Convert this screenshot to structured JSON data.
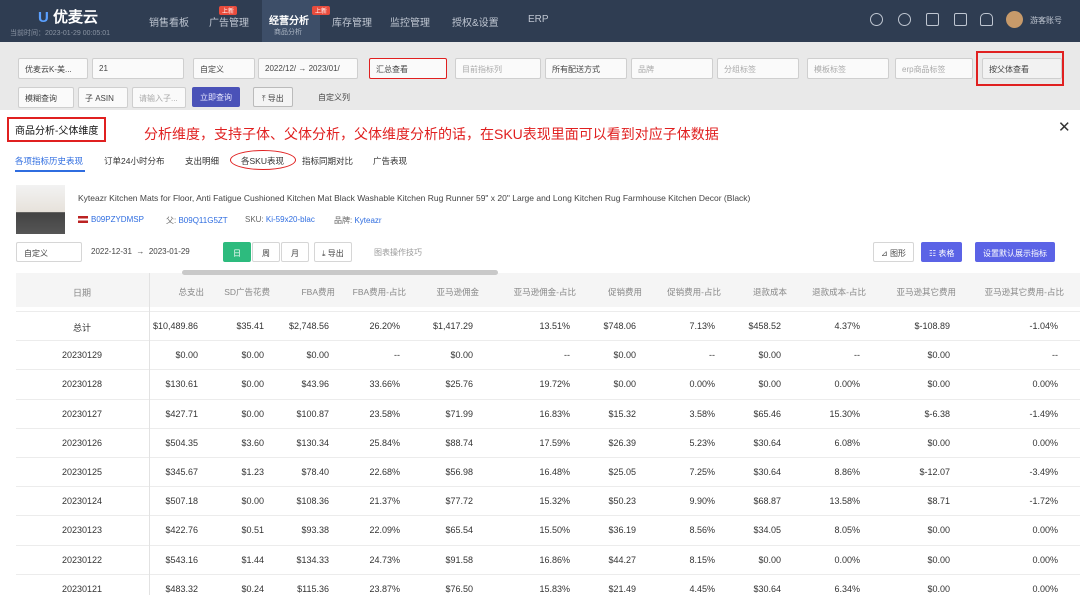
{
  "app": {
    "logo": "优麦云",
    "sub": "当前时间：2023-01-29 00:05:01"
  },
  "nav": [
    {
      "label": "销售看板",
      "badge": ""
    },
    {
      "label": "广告管理",
      "badge": "上新"
    },
    {
      "label": "经营分析",
      "badge": "上新",
      "sub": "商品分析"
    },
    {
      "label": "库存管理",
      "badge": ""
    },
    {
      "label": "监控管理",
      "badge": ""
    },
    {
      "label": "授权&设置",
      "badge": ""
    },
    {
      "label": "ERP",
      "badge": ""
    }
  ],
  "user": {
    "name": "游客账号"
  },
  "filters": {
    "store": "优麦云K-美...",
    "count": "21",
    "mode": "自定义",
    "start": "2022/12/",
    "end": "2023/01/",
    "summary": "汇总查看",
    "p1": "目前指标列",
    "ship": "所有配送方式",
    "p2": "品牌",
    "p3": "分组标签",
    "p4": "模板标签",
    "p5": "erp商品标签",
    "parent_view": "按父体查看",
    "search_mode": "模糊查询",
    "asin": "子 ASIN",
    "asin_ph": "请输入子...",
    "search_btn": "立即查询",
    "export": "导出",
    "custom_cols": "自定义列"
  },
  "panel": {
    "title": "商品分析-父体维度",
    "annotation": "分析维度，支持子体、父体分析，父体维度分析的话，在SKU表现里面可以看到对应子体数据",
    "tabs": [
      "各项指标历史表现",
      "订单24小时分布",
      "支出明细",
      "各SKU表现",
      "指标同期对比",
      "广告表现"
    ],
    "product": {
      "name": "Kyteazr Kitchen Mats for Floor, Anti Fatigue Cushioned Kitchen Mat Black Washable Kitchen Rug Runner 59\" x 20\" Large and Long Kitchen Rug Farmhouse Kitchen Decor (Black)",
      "asin": "B09PZYDMSP",
      "parent_label": "父:",
      "parent": "B09Q11G5ZT",
      "sku_label": "SKU:",
      "sku": "Ki-59x20-blac",
      "brand_label": "品牌:",
      "brand": "Kyteazr"
    },
    "controls": {
      "mode": "自定义",
      "start": "2022-12-31",
      "arrow": "→",
      "end": "2023-01-29",
      "day": "日",
      "week": "周",
      "month": "月",
      "export": "导出",
      "tip": "图表操作技巧",
      "chart": "图形",
      "table": "表格",
      "default_btn": "设置默认展示指标"
    }
  },
  "table": {
    "headers": [
      "日期",
      "总支出",
      "SD广告花费",
      "FBA费用",
      "FBA费用-占比",
      "亚马逊佣金",
      "亚马逊佣金-占比",
      "促销费用",
      "促销费用-占比",
      "退款成本",
      "退款成本-占比",
      "亚马逊其它费用",
      "亚马逊其它费用-占比"
    ],
    "rows": [
      [
        "总计",
        "$10,489.86",
        "$35.41",
        "$2,748.56",
        "26.20%",
        "$1,417.29",
        "13.51%",
        "$748.06",
        "7.13%",
        "$458.52",
        "4.37%",
        "$-108.89",
        "-1.04%"
      ],
      [
        "20230129",
        "$0.00",
        "$0.00",
        "$0.00",
        "--",
        "$0.00",
        "--",
        "$0.00",
        "--",
        "$0.00",
        "--",
        "$0.00",
        "--"
      ],
      [
        "20230128",
        "$130.61",
        "$0.00",
        "$43.96",
        "33.66%",
        "$25.76",
        "19.72%",
        "$0.00",
        "0.00%",
        "$0.00",
        "0.00%",
        "$0.00",
        "0.00%"
      ],
      [
        "20230127",
        "$427.71",
        "$0.00",
        "$100.87",
        "23.58%",
        "$71.99",
        "16.83%",
        "$15.32",
        "3.58%",
        "$65.46",
        "15.30%",
        "$-6.38",
        "-1.49%"
      ],
      [
        "20230126",
        "$504.35",
        "$3.60",
        "$130.34",
        "25.84%",
        "$88.74",
        "17.59%",
        "$26.39",
        "5.23%",
        "$30.64",
        "6.08%",
        "$0.00",
        "0.00%"
      ],
      [
        "20230125",
        "$345.67",
        "$1.23",
        "$78.40",
        "22.68%",
        "$56.98",
        "16.48%",
        "$25.05",
        "7.25%",
        "$30.64",
        "8.86%",
        "$-12.07",
        "-3.49%"
      ],
      [
        "20230124",
        "$507.18",
        "$0.00",
        "$108.36",
        "21.37%",
        "$77.72",
        "15.32%",
        "$50.23",
        "9.90%",
        "$68.87",
        "13.58%",
        "$8.71",
        "-1.72%"
      ],
      [
        "20230123",
        "$422.76",
        "$0.51",
        "$93.38",
        "22.09%",
        "$65.54",
        "15.50%",
        "$36.19",
        "8.56%",
        "$34.05",
        "8.05%",
        "$0.00",
        "0.00%"
      ],
      [
        "20230122",
        "$543.16",
        "$1.44",
        "$134.33",
        "24.73%",
        "$91.58",
        "16.86%",
        "$44.27",
        "8.15%",
        "$0.00",
        "0.00%",
        "$0.00",
        "0.00%"
      ],
      [
        "20230121",
        "$483.32",
        "$0.24",
        "$115.36",
        "23.87%",
        "$76.50",
        "15.83%",
        "$21.49",
        "4.45%",
        "$30.64",
        "6.34%",
        "$0.00",
        "0.00%"
      ]
    ]
  }
}
